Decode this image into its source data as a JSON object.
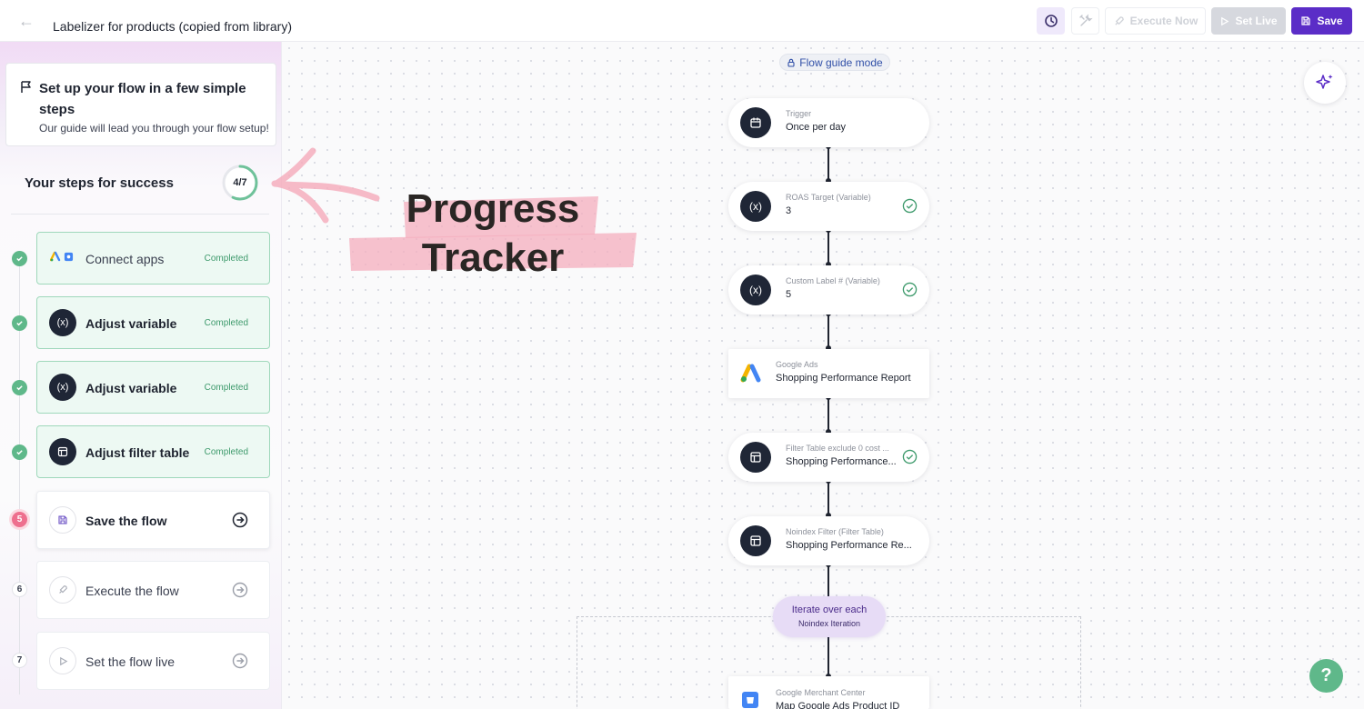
{
  "header": {
    "title": "Labelizer for products (copied from library)",
    "execute_label": "Execute Now",
    "set_live_label": "Set Live",
    "save_label": "Save"
  },
  "sidebar": {
    "guide_title": "Set up your flow in a few simple steps",
    "guide_subtitle": "Our guide will lead you through your flow setup!",
    "steps_title": "Your steps for success",
    "progress_label": "4/7",
    "progress_fraction": 0.571,
    "steps": [
      {
        "label": "Connect apps",
        "status": "Completed",
        "state": "done"
      },
      {
        "label": "Adjust variable",
        "status": "Completed",
        "state": "done"
      },
      {
        "label": "Adjust variable",
        "status": "Completed",
        "state": "done"
      },
      {
        "label": "Adjust filter table",
        "status": "Completed",
        "state": "done"
      },
      {
        "label": "Save the flow",
        "number": "5",
        "state": "active"
      },
      {
        "label": "Execute the flow",
        "number": "6",
        "state": "pending"
      },
      {
        "label": "Set the flow live",
        "number": "7",
        "state": "pending"
      }
    ]
  },
  "canvas": {
    "mode_label": "Flow guide mode",
    "help_label": "?",
    "nodes": [
      {
        "caption": "Trigger",
        "value": "Once per day",
        "icon": "calendar-icon"
      },
      {
        "caption": "ROAS Target (Variable)",
        "value": "3",
        "icon": "variable-icon",
        "checked": true
      },
      {
        "caption": "Custom Label # (Variable)",
        "value": "5",
        "icon": "variable-icon",
        "checked": true
      },
      {
        "caption": "Google Ads",
        "value": "Shopping Performance Report",
        "icon": "google-ads-icon"
      },
      {
        "caption": "Filter Table exclude 0 cost ...",
        "value": "Shopping Performance...",
        "icon": "table-icon",
        "checked": true
      },
      {
        "caption": "Noindex Filter (Filter Table)",
        "value": "Shopping Performance Re...",
        "icon": "table-icon"
      },
      {
        "caption": "Google Merchant Center",
        "value": "Map Google Ads Product ID",
        "icon": "merchant-center-icon"
      }
    ],
    "iterator": {
      "title": "Iterate over each",
      "subtitle": "Noindex Iteration"
    }
  },
  "annotation": {
    "line1": "Progress",
    "line2": "Tracker",
    "color": "#f4aebd"
  }
}
